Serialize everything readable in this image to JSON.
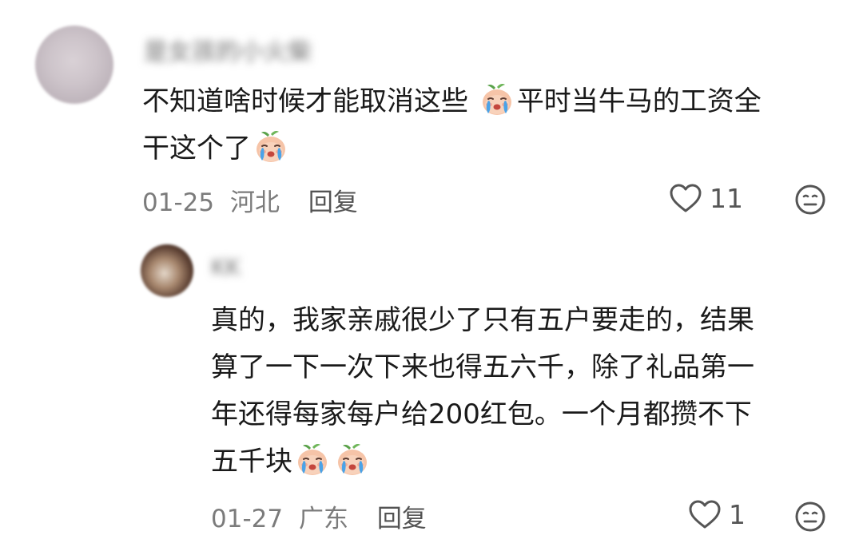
{
  "comments": [
    {
      "username": "是女孩的小火柴",
      "lines": [
        [
          "不知道啥时候才能取消这些 ",
          {
            "emoji": "crying-peach-emoji"
          },
          "平时当牛马的工资全"
        ],
        [
          "干这个了",
          {
            "emoji": "crying-peach-emoji"
          }
        ]
      ],
      "date": "01-25",
      "location": "河北",
      "reply_label": "回复",
      "likes": "11"
    },
    {
      "username": "KK",
      "lines": [
        [
          "真的，我家亲戚很少了只有五户要走的，结果"
        ],
        [
          "算了一下一次下来也得五六千，除了礼品第一"
        ],
        [
          "年还得每家每户给200红包。一个月都攒不下"
        ],
        [
          "五千块",
          {
            "emoji": "crying-peach-emoji"
          },
          {
            "emoji": "crying-peach-emoji"
          }
        ]
      ],
      "date": "01-27",
      "location": "广东",
      "reply_label": "回复",
      "likes": "1"
    }
  ],
  "icons": {
    "like": "heart-outline-icon",
    "dislike": "neutral-face-icon",
    "emoji": "crying-peach-emoji"
  },
  "colors": {
    "text": "#1a1a1a",
    "meta": "#7b7b7b",
    "icon": "#555555"
  }
}
